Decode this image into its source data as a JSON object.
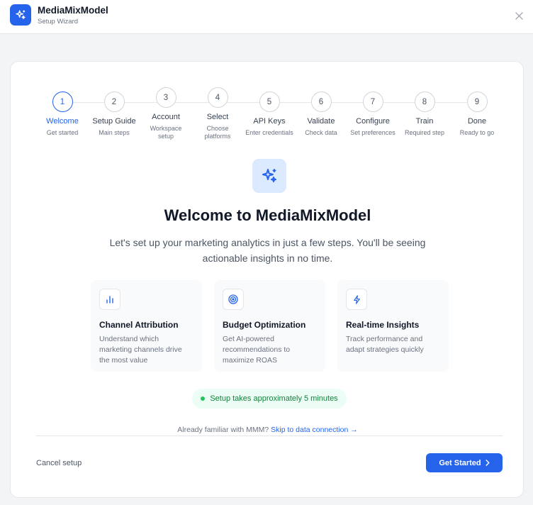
{
  "header": {
    "title": "MediaMixModel",
    "subtitle": "Setup Wizard",
    "app_icon": "sparkles-icon",
    "close_icon": "close-icon"
  },
  "stepper": {
    "active_step": 1,
    "steps": [
      {
        "number": "1",
        "label": "Welcome",
        "desc": "Get started"
      },
      {
        "number": "2",
        "label": "Setup Guide",
        "desc": "Main steps"
      },
      {
        "number": "3",
        "label": "Account",
        "desc": "Workspace setup"
      },
      {
        "number": "4",
        "label": "Select",
        "desc": "Choose platforms"
      },
      {
        "number": "5",
        "label": "API Keys",
        "desc": "Enter credentials"
      },
      {
        "number": "6",
        "label": "Validate",
        "desc": "Check data"
      },
      {
        "number": "7",
        "label": "Configure",
        "desc": "Set preferences"
      },
      {
        "number": "8",
        "label": "Train",
        "desc": "Required step"
      },
      {
        "number": "9",
        "label": "Done",
        "desc": "Ready to go"
      }
    ]
  },
  "hero": {
    "icon": "sparkles-icon",
    "title": "Welcome to MediaMixModel",
    "text": "Let's set up your marketing analytics in just a few steps. You'll be seeing actionable insights in no time."
  },
  "features": [
    {
      "icon": "bar-chart-icon",
      "title": "Channel Attribution",
      "desc": "Understand which marketing channels drive the most value"
    },
    {
      "icon": "target-icon",
      "title": "Budget Optimization",
      "desc": "Get AI-powered recommendations to maximize ROAS"
    },
    {
      "icon": "lightning-icon",
      "title": "Real-time Insights",
      "desc": "Track performance and adapt strategies quickly"
    }
  ],
  "time_badge": "Setup takes approximately 5 minutes",
  "skip": {
    "prefix": "Already familiar with MMM?",
    "link": "Skip to data connection →"
  },
  "footer": {
    "cancel": "Cancel setup",
    "primary": "Get Started"
  },
  "colors": {
    "accent": "#2563eb",
    "accent_light": "#dbeafe",
    "success": "#15803d",
    "success_bg": "#ecfdf5"
  }
}
